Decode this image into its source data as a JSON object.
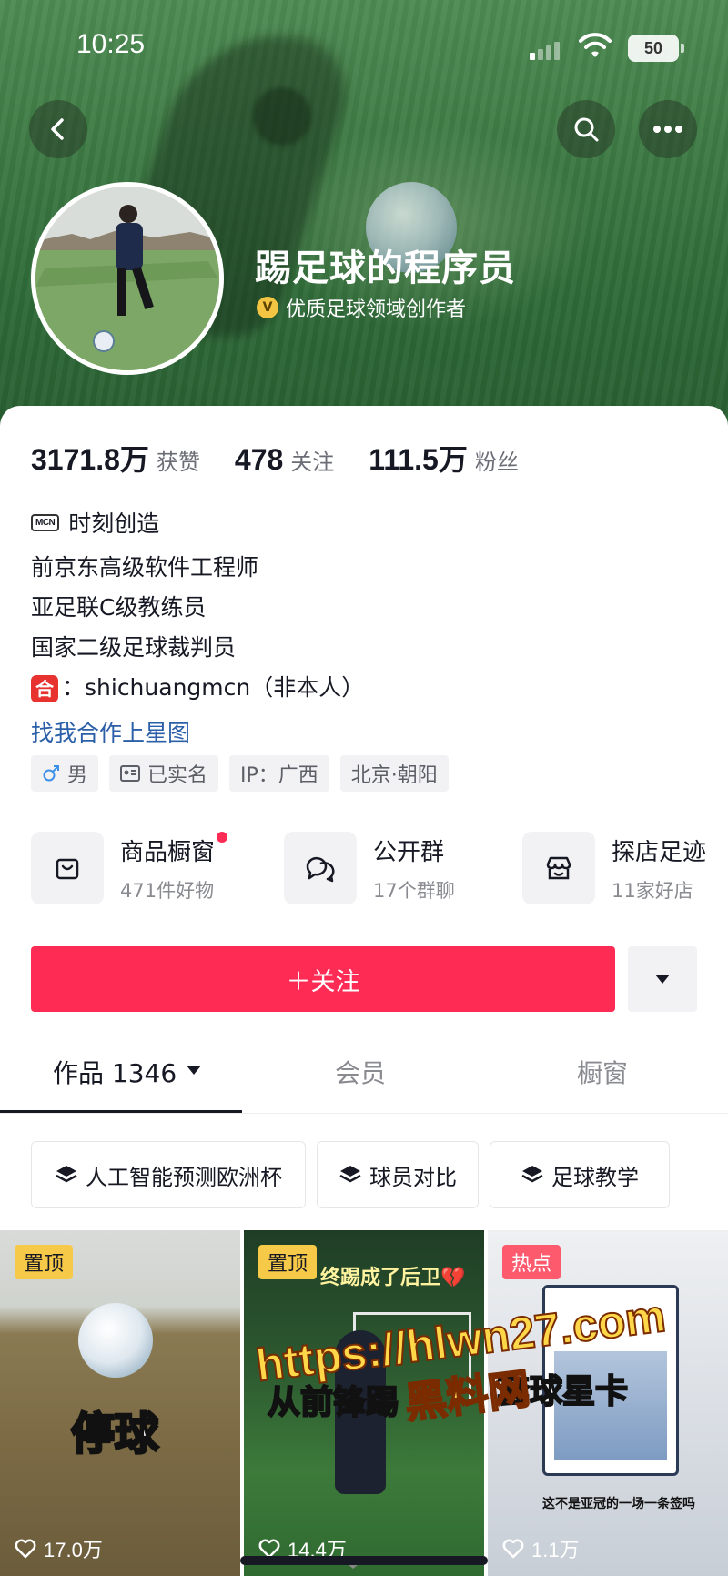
{
  "status_bar": {
    "time": "10:25",
    "battery": "50"
  },
  "profile": {
    "name": "踢足球的程序员",
    "verified_label": "优质足球领域创作者",
    "stats": [
      {
        "num": "3171.8万",
        "label": "获赞"
      },
      {
        "num": "478",
        "label": "关注"
      },
      {
        "num": "111.5万",
        "label": "粉丝"
      }
    ],
    "mcn_badge": "MCN",
    "mcn_name": "时刻创造",
    "bio": [
      "前京东高级软件工程师",
      "亚足联C级教练员",
      "国家二级足球裁判员"
    ],
    "cooperation_icon": "合",
    "cooperation_text": "：shichuangmcn（非本人）",
    "link": "找我合作上星图",
    "tags": [
      {
        "icon": "male-icon",
        "text": "男"
      },
      {
        "icon": "id-card-icon",
        "text": "已实名"
      },
      {
        "icon": "",
        "text": "IP：广西"
      },
      {
        "icon": "",
        "text": "北京·朝阳"
      }
    ]
  },
  "features": [
    {
      "icon": "shop-bag-icon",
      "title": "商品橱窗",
      "sub": "471件好物",
      "dot": true
    },
    {
      "icon": "group-chat-icon",
      "title": "公开群",
      "sub": "17个群聊",
      "dot": false
    },
    {
      "icon": "store-icon",
      "title": "探店足迹",
      "sub": "11家好店",
      "dot": false
    }
  ],
  "actions": {
    "follow": "＋关注"
  },
  "tabs": [
    {
      "label": "作品 1346",
      "active": true
    },
    {
      "label": "会员",
      "active": false
    },
    {
      "label": "橱窗",
      "active": false
    }
  ],
  "collections": [
    "人工智能预测欧洲杯",
    "球员对比",
    "足球教学"
  ],
  "videos": [
    {
      "badge": "置顶",
      "likes": "17.0万",
      "overlay": "停球"
    },
    {
      "badge": "置顶",
      "likes": "14.4万",
      "caption": "终踢成了后卫💔",
      "overlay": "从前锋踢"
    },
    {
      "badge": "热点",
      "likes": "1.1万",
      "caption": "这不是亚冠的一场一条签吗",
      "overlay": "套球星卡"
    }
  ],
  "watermark": {
    "line1": "https://hlwn27.com",
    "line2": "黑料网"
  },
  "colors": {
    "accent": "#fe2c55",
    "link": "#2b5fa8",
    "pin": "#f7c948",
    "hot": "#fe5a6e"
  }
}
